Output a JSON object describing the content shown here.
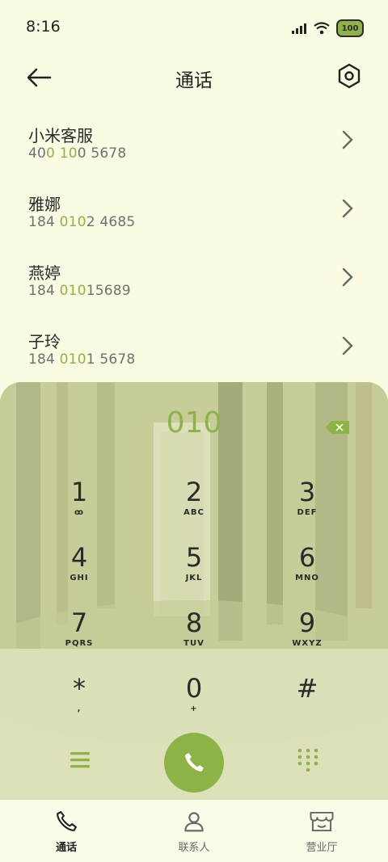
{
  "status_bar": {
    "time": "8:16",
    "battery": "100"
  },
  "header": {
    "title": "通话"
  },
  "calls": [
    {
      "name": "小米客服",
      "number_parts": [
        "40",
        "0",
        " ",
        "10",
        "0 5678"
      ]
    },
    {
      "name": "雅娜",
      "number_parts": [
        "184 ",
        "010",
        "2 4685",
        "",
        ""
      ]
    },
    {
      "name": "燕婷",
      "number_parts": [
        "184 ",
        "010",
        "15689",
        "",
        ""
      ]
    },
    {
      "name": "子玲",
      "number_parts": [
        "184 ",
        "010",
        "1 5678",
        "",
        ""
      ]
    }
  ],
  "dialpad": {
    "input": "010",
    "keys": [
      {
        "digit": "1",
        "sub": "ꝏ"
      },
      {
        "digit": "2",
        "sub": "ABC"
      },
      {
        "digit": "3",
        "sub": "DEF"
      },
      {
        "digit": "4",
        "sub": "GHI"
      },
      {
        "digit": "5",
        "sub": "JKL"
      },
      {
        "digit": "6",
        "sub": "MNO"
      },
      {
        "digit": "7",
        "sub": "PQRS"
      },
      {
        "digit": "8",
        "sub": "TUV"
      },
      {
        "digit": "9",
        "sub": "WXYZ"
      },
      {
        "digit": "*",
        "sub": ","
      },
      {
        "digit": "0",
        "sub": "+"
      },
      {
        "digit": "#",
        "sub": ""
      }
    ]
  },
  "bottom_nav": [
    {
      "label": "通话",
      "icon": "phone-icon",
      "active": true
    },
    {
      "label": "联系人",
      "icon": "person-icon",
      "active": false
    },
    {
      "label": "营业厅",
      "icon": "store-icon",
      "active": false
    }
  ],
  "colors": {
    "accent": "#8bb346",
    "background": "#fbfbe3",
    "text": "#2a2a2a",
    "muted": "#707070"
  }
}
